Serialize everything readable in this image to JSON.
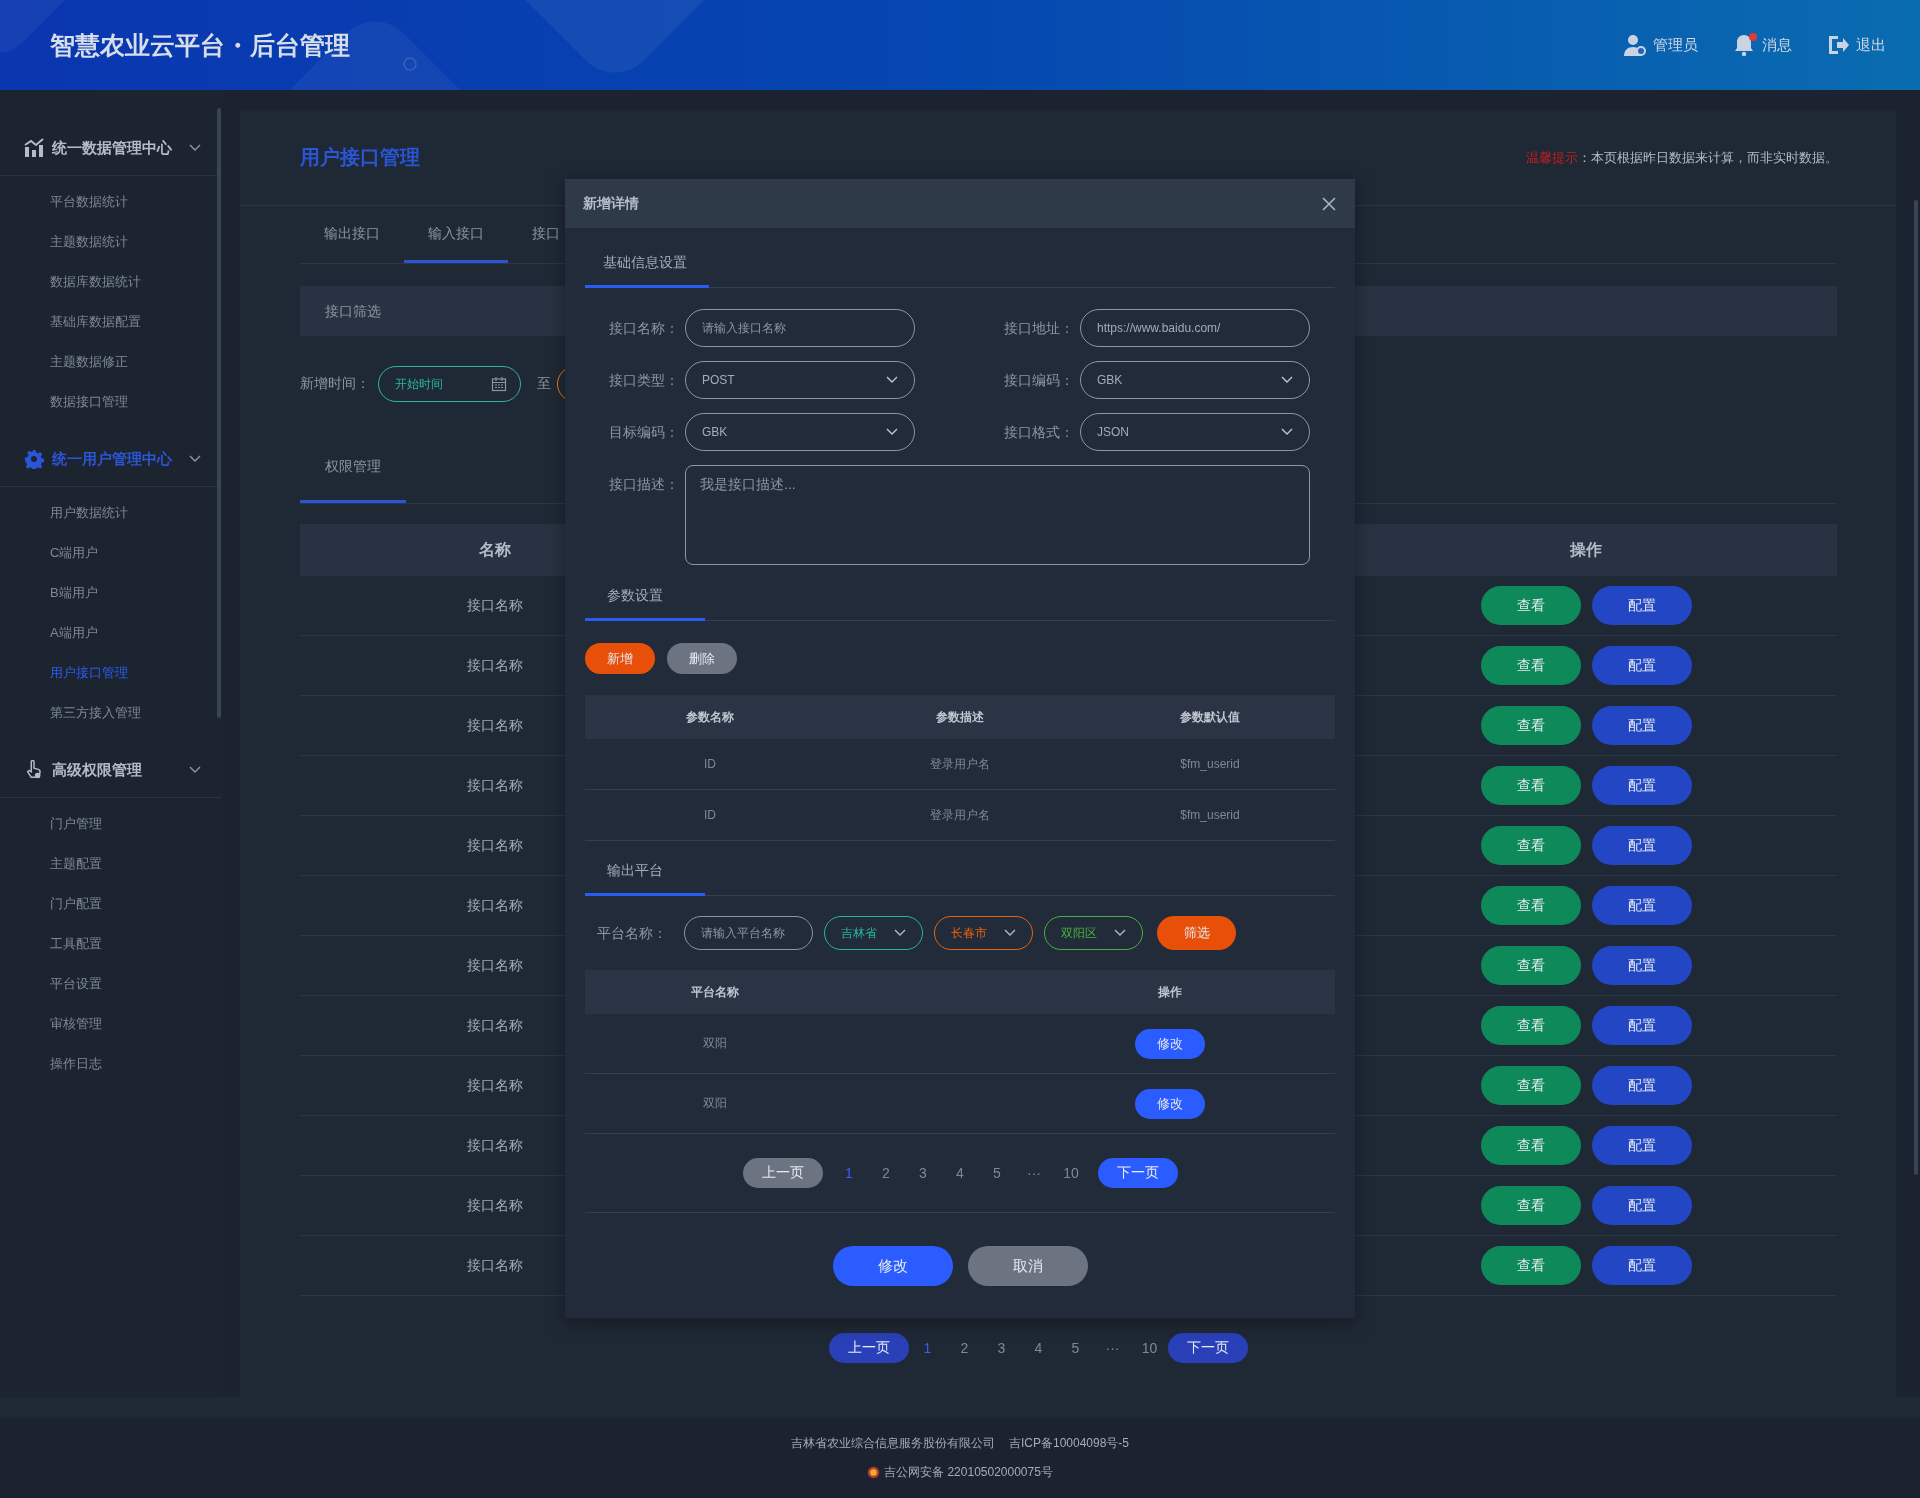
{
  "header": {
    "title": "智慧农业云平台・后台管理",
    "actions": [
      {
        "kind": "user",
        "label": "管理员",
        "unread": false
      },
      {
        "kind": "bell",
        "label": "消息",
        "unread": true
      },
      {
        "kind": "exit",
        "label": "退出",
        "unread": false
      }
    ]
  },
  "sidebar": {
    "groups": [
      {
        "kind": "chart",
        "title": "统一数据管理中心",
        "active": false,
        "expanded": true,
        "items": [
          {
            "label": "平台数据统计",
            "selected": false
          },
          {
            "label": "主题数据统计",
            "selected": false
          },
          {
            "label": "数据库数据统计",
            "selected": false
          },
          {
            "label": "基础库数据配置",
            "selected": false
          },
          {
            "label": "主题数据修正",
            "selected": false
          },
          {
            "label": "数据接口管理",
            "selected": false
          }
        ]
      },
      {
        "kind": "gear",
        "title": "统一用户管理中心",
        "active": true,
        "expanded": true,
        "items": [
          {
            "label": "用户数据统计",
            "selected": false
          },
          {
            "label": "C端用户",
            "selected": false
          },
          {
            "label": "B端用户",
            "selected": false
          },
          {
            "label": "A端用户",
            "selected": false
          },
          {
            "label": "用户接口管理",
            "selected": true
          },
          {
            "label": "第三方接入管理",
            "selected": false
          }
        ]
      },
      {
        "kind": "hand",
        "title": "高级权限管理",
        "active": false,
        "expanded": true,
        "items": [
          {
            "label": "门户管理",
            "selected": false
          },
          {
            "label": "主题配置",
            "selected": false
          },
          {
            "label": "门户配置",
            "selected": false
          },
          {
            "label": "工具配置",
            "selected": false
          },
          {
            "label": "平台设置",
            "selected": false
          },
          {
            "label": "审核管理",
            "selected": false
          },
          {
            "label": "操作日志",
            "selected": false
          }
        ]
      }
    ]
  },
  "page": {
    "title": "用户接口管理",
    "notice": {
      "label": "温馨提示",
      "text": "：本页根据昨日数据来计算，而非实时数据。"
    },
    "tabs": [
      {
        "label": "输出接口",
        "selected": false
      },
      {
        "label": "输入接口",
        "selected": true
      },
      {
        "label": "接口",
        "selected": false
      }
    ],
    "filter": {
      "title": "接口筛选",
      "date_label": "新增时间：",
      "start_placeholder": "开始时间",
      "separator": "至"
    },
    "section_tab": {
      "label": "权限管理",
      "selected": true
    },
    "table": {
      "columns": [
        "名称",
        "操作"
      ],
      "rows": [
        {
          "name": "接口名称",
          "actions": [
            {
              "kind": "view",
              "label": "查看"
            },
            {
              "kind": "config",
              "label": "配置"
            }
          ]
        },
        {
          "name": "接口名称",
          "actions": [
            {
              "kind": "view",
              "label": "查看"
            },
            {
              "kind": "config",
              "label": "配置"
            }
          ]
        },
        {
          "name": "接口名称",
          "actions": [
            {
              "kind": "view",
              "label": "查看"
            },
            {
              "kind": "config",
              "label": "配置"
            }
          ]
        },
        {
          "name": "接口名称",
          "actions": [
            {
              "kind": "view",
              "label": "查看"
            },
            {
              "kind": "config",
              "label": "配置"
            }
          ]
        },
        {
          "name": "接口名称",
          "actions": [
            {
              "kind": "view",
              "label": "查看"
            },
            {
              "kind": "config",
              "label": "配置"
            }
          ]
        },
        {
          "name": "接口名称",
          "actions": [
            {
              "kind": "view",
              "label": "查看"
            },
            {
              "kind": "config",
              "label": "配置"
            }
          ]
        },
        {
          "name": "接口名称",
          "actions": [
            {
              "kind": "view",
              "label": "查看"
            },
            {
              "kind": "config",
              "label": "配置"
            }
          ]
        },
        {
          "name": "接口名称",
          "actions": [
            {
              "kind": "view",
              "label": "查看"
            },
            {
              "kind": "config",
              "label": "配置"
            }
          ]
        },
        {
          "name": "接口名称",
          "actions": [
            {
              "kind": "view",
              "label": "查看"
            },
            {
              "kind": "config",
              "label": "配置"
            }
          ]
        },
        {
          "name": "接口名称",
          "actions": [
            {
              "kind": "view",
              "label": "查看"
            },
            {
              "kind": "config",
              "label": "配置"
            }
          ]
        },
        {
          "name": "接口名称",
          "actions": [
            {
              "kind": "view",
              "label": "查看"
            },
            {
              "kind": "config",
              "label": "配置"
            }
          ]
        },
        {
          "name": "接口名称",
          "actions": [
            {
              "kind": "view",
              "label": "查看"
            },
            {
              "kind": "config",
              "label": "配置"
            }
          ]
        }
      ]
    },
    "pagination": {
      "prev": "上一页",
      "next": "下一页",
      "pages": [
        {
          "label": "1",
          "selected": true
        },
        {
          "label": "2",
          "selected": false
        },
        {
          "label": "3",
          "selected": false
        },
        {
          "label": "4",
          "selected": false
        },
        {
          "label": "5",
          "selected": false
        },
        {
          "label": "···",
          "selected": false
        },
        {
          "label": "10",
          "selected": false
        }
      ]
    }
  },
  "dialog": {
    "title": "新增详情",
    "basic": {
      "tab": "基础信息设置",
      "fields": [
        {
          "kind": "text",
          "label": "接口名称：",
          "placeholder": "请输入接口名称"
        },
        {
          "kind": "text",
          "label": "接口地址：",
          "value": "https://www.baidu.com/"
        },
        {
          "kind": "select",
          "label": "接口类型：",
          "value": "POST"
        },
        {
          "kind": "select",
          "label": "接口编码：",
          "value": "GBK"
        },
        {
          "kind": "select",
          "label": "目标编码：",
          "value": "GBK"
        },
        {
          "kind": "select",
          "label": "接口格式：",
          "value": "JSON"
        },
        {
          "kind": "textarea",
          "label": "接口描述：",
          "placeholder": "我是接口描述..."
        }
      ]
    },
    "params": {
      "tab": "参数设置",
      "buttons": [
        {
          "kind": "add",
          "label": "新增"
        },
        {
          "kind": "delete",
          "label": "删除"
        }
      ],
      "columns": [
        "参数名称",
        "参数描述",
        "参数默认值"
      ],
      "rows": [
        [
          "ID",
          "登录用户名",
          "$fm_userid"
        ],
        [
          "ID",
          "登录用户名",
          "$fm_userid"
        ]
      ]
    },
    "platforms": {
      "tab": "输出平台",
      "filter_label": "平台名称：",
      "filter_placeholder": "请输入平台名称",
      "selects": [
        {
          "value": "吉林省",
          "color": "#2bb5a0"
        },
        {
          "value": "长春市",
          "color": "#e8630a"
        },
        {
          "value": "双阳区",
          "color": "#4caf3e"
        }
      ],
      "filter_button": "筛选",
      "columns": [
        "平台名称",
        "操作"
      ],
      "rows": [
        {
          "name": "双阳",
          "action": "修改"
        },
        {
          "name": "双阳",
          "action": "修改"
        }
      ],
      "pagination": {
        "prev": "上一页",
        "next": "下一页",
        "pages": [
          {
            "label": "1",
            "selected": true
          },
          {
            "label": "2",
            "selected": false
          },
          {
            "label": "3",
            "selected": false
          },
          {
            "label": "4",
            "selected": false
          },
          {
            "label": "5",
            "selected": false
          },
          {
            "label": "···",
            "selected": false
          },
          {
            "label": "10",
            "selected": false
          }
        ]
      }
    },
    "buttons": [
      {
        "kind": "primary",
        "label": "修改"
      },
      {
        "kind": "cancel",
        "label": "取消"
      }
    ]
  },
  "footer": {
    "company": "吉林省农业综合信息服务股份有限公司",
    "icp": "吉ICP备10004098号-5",
    "police": "吉公网安备 22010502000075号"
  }
}
